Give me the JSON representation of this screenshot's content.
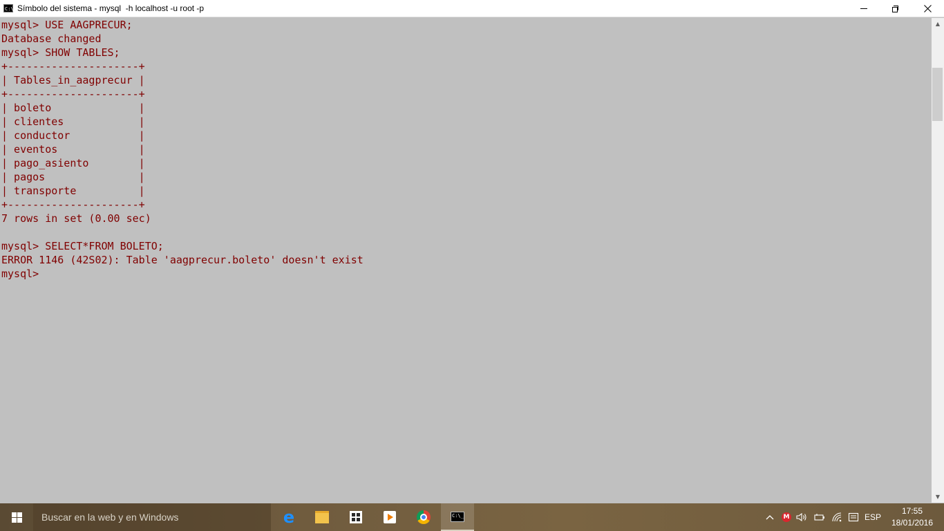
{
  "window": {
    "title": "Símbolo del sistema - mysql  -h localhost -u root -p",
    "icon": "cmd-icon",
    "controls": [
      "minimize",
      "restore",
      "close"
    ]
  },
  "console": {
    "text_color": "#800000",
    "background_color": "#c0c0c0",
    "lines": [
      "mysql> USE AAGPRECUR;",
      "Database changed",
      "mysql> SHOW TABLES;",
      "+---------------------+",
      "| Tables_in_aagprecur |",
      "+---------------------+",
      "| boleto              |",
      "| clientes            |",
      "| conductor           |",
      "| eventos             |",
      "| pago_asiento        |",
      "| pagos               |",
      "| transporte          |",
      "+---------------------+",
      "7 rows in set (0.00 sec)",
      "",
      "mysql> SELECT*FROM BOLETO;",
      "ERROR 1146 (42S02): Table 'aagprecur.boleto' doesn't exist",
      "mysql>"
    ]
  },
  "taskbar": {
    "search_placeholder": "Buscar en la web y en Windows",
    "pinned_icons": [
      "edge-icon",
      "file-explorer-icon",
      "store-icon",
      "media-player-icon",
      "chrome-icon",
      "cmd-icon"
    ],
    "active_app": "cmd-icon",
    "tray": {
      "language": "ESP",
      "time": "17:55",
      "date": "18/01/2016",
      "icons": [
        "chevron-up-icon",
        "mega-icon",
        "volume-icon",
        "battery-icon",
        "wifi-icon",
        "notifications-icon"
      ]
    }
  }
}
